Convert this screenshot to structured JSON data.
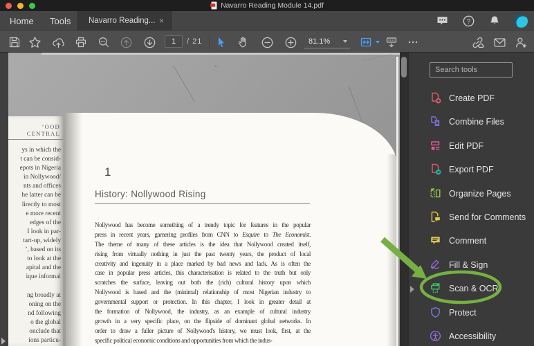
{
  "window": {
    "title": "Navarro Reading Module 14.pdf",
    "traffic_light_colors": [
      "#f45c51",
      "#f3b62f",
      "#3ec843"
    ]
  },
  "tab_bar": {
    "home": "Home",
    "tools": "Tools",
    "document_tab": "Navarro Reading...",
    "close": "×"
  },
  "toolbar": {
    "page_number": "1",
    "page_total": "/ 21",
    "zoom_level": "81.1%",
    "accent_color": "#4f9cf7"
  },
  "tools_panel": {
    "search_placeholder": "Search tools",
    "items": [
      {
        "id": "create-pdf",
        "label": "Create PDF",
        "color": "#e25d68"
      },
      {
        "id": "combine-files",
        "label": "Combine Files",
        "color": "#7e70e0"
      },
      {
        "id": "edit-pdf",
        "label": "Edit PDF",
        "color": "#e257a2"
      },
      {
        "id": "export-pdf",
        "label": "Export PDF",
        "color": "#e05c6a",
        "accent": "#1ab8a8"
      },
      {
        "id": "organize-pages",
        "label": "Organize Pages",
        "color": "#93c94e"
      },
      {
        "id": "send-for-comments",
        "label": "Send for Comments",
        "color": "#e3c84a"
      },
      {
        "id": "comment",
        "label": "Comment",
        "color": "#e3c84a"
      },
      {
        "id": "fill-sign",
        "label": "Fill & Sign",
        "color": "#9c6ade"
      },
      {
        "id": "scan-ocr",
        "label": "Scan & OCR",
        "color": "#3fc566"
      },
      {
        "id": "protect",
        "label": "Protect",
        "color": "#7d7ae8"
      },
      {
        "id": "accessibility",
        "label": "Accessibility",
        "color": "#9c6ade"
      }
    ]
  },
  "document": {
    "left_page": {
      "header": "’OOD CENTRAL",
      "lines": [
        "ys in which the",
        "t can be consid-",
        "epots in Nigeria",
        " in Nollywood/",
        "nts and offices",
        "he latter can be",
        "lirectly to most",
        "e more recent",
        " edges of the",
        "I look in par-",
        "tart-up, widely",
        "’, based on its",
        "to look at the",
        "apital and the",
        "ique informal",
        "",
        "ng broadly at",
        "oning on the",
        "nd following",
        "o the global",
        "onclude that",
        "ions particu-"
      ]
    },
    "right_page": {
      "chapter_number": "1",
      "heading": "History: Nollywood Rising",
      "body": {
        "first_line": "Nollywood has become something of a trendy topic for features in the popular",
        "second_line": {
          "a": "press in recent years, garnering profiles from CNN to ",
          "b": "Esquire",
          "c": " to ",
          "d": "The Economist",
          "e": "."
        },
        "rest_lines": [
          "The theme of many of these articles is the idea that Nollywood created itself,",
          "rising from virtually nothing in just the past twenty years, the product of local",
          "creativity and ingenuity in a place marked by bad news and lack. As is often the",
          "case in popular press articles, this characterisation is related to the truth but only",
          "scratches the surface, leaving out both the (rich) cultural history upon which",
          "Nollywood is based and the (minimal) relationship of most Nigerian industry to",
          "governmental support or protection. In this chapter, I look in greater detail at",
          "the formation of Nollywood, the industry, as an example of cultural industry",
          "growth in a very specific place, on the flipside of dominant global networks. In",
          "order to draw a fuller picture of Nollywood's history, we must look, first, at the",
          "specific political economic conditions and opportunities from which the indus-"
        ]
      }
    }
  },
  "annotation": {
    "color": "#76b043"
  }
}
